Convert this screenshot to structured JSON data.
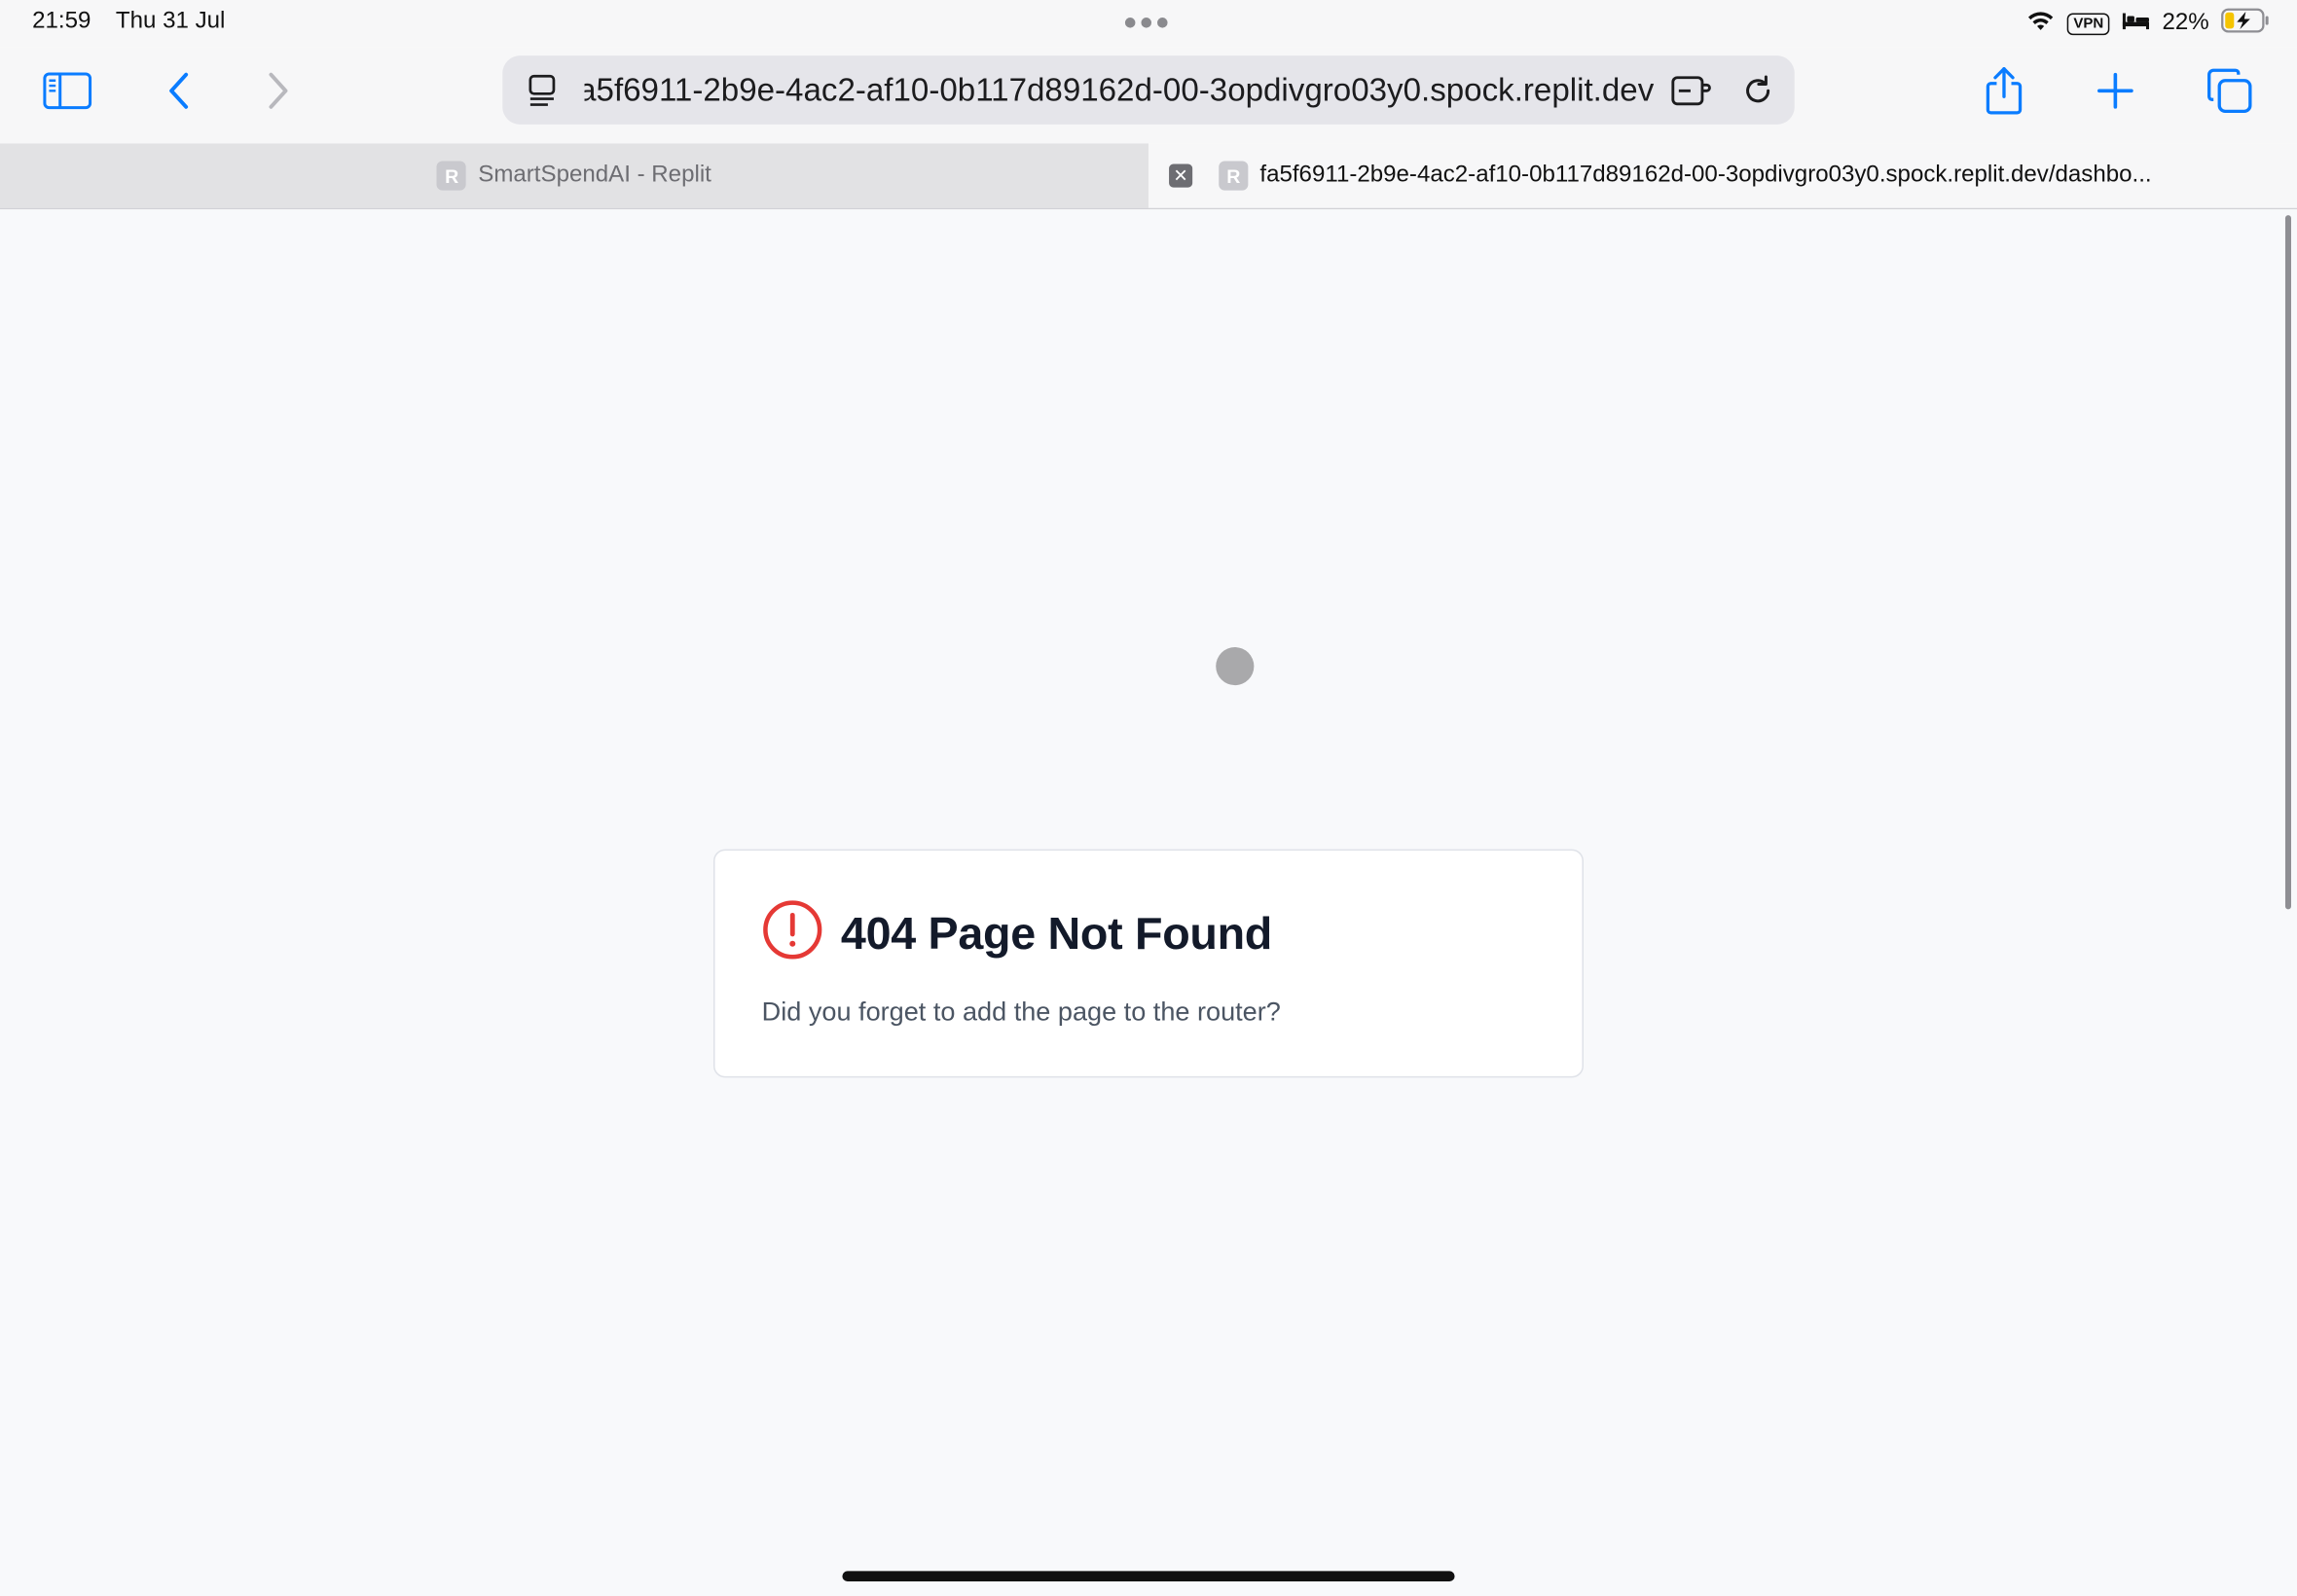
{
  "status_bar": {
    "time": "21:59",
    "date": "Thu 31 Jul",
    "vpn_label": "VPN",
    "battery_percent": "22%",
    "icons": [
      "wifi-icon",
      "bed-icon",
      "battery-charging-icon"
    ]
  },
  "toolbar": {
    "address_text": "fa5f6911-2b9e-4ac2-af10-0b117d89162d-00-3opdivgro03y0.spock.replit.dev",
    "accent": "#0a7cff",
    "icons": [
      "sidebar-icon",
      "back-icon",
      "forward-icon",
      "page-menu-icon",
      "extensions-icon",
      "reload-icon",
      "share-icon",
      "new-tab-icon",
      "tabs-overview-icon"
    ]
  },
  "tabs": [
    {
      "favicon": "R",
      "title": "SmartSpendAI - Replit",
      "active": false
    },
    {
      "favicon": "R",
      "title": "fa5f6911-2b9e-4ac2-af10-0b117d89162d-00-3opdivgro03y0.spock.replit.dev/dashbo...",
      "active": true
    }
  ],
  "page": {
    "error_title": "404 Page Not Found",
    "error_message": "Did you forget to add the page to the router?",
    "error_color": "#e53935"
  }
}
